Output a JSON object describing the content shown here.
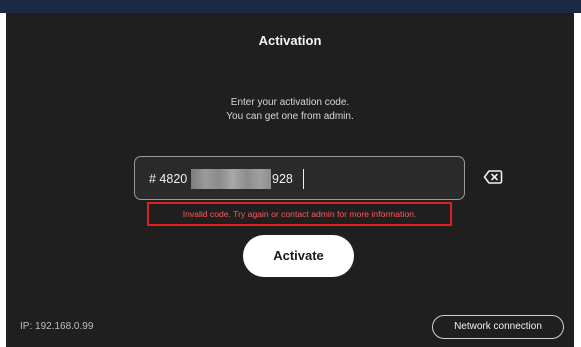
{
  "screen": {
    "title": "Activation",
    "instruction_line1": "Enter your activation code.",
    "instruction_line2": "You can get one from admin."
  },
  "code_input": {
    "prefix": "# 4820",
    "suffix": "928",
    "redacted": true
  },
  "error": {
    "message": "Invalid code. Try again or contact admin for more information.",
    "color": "#ff5a5a",
    "highlight_color": "#e02020"
  },
  "actions": {
    "activate_label": "Activate",
    "network_label": "Network connection"
  },
  "status": {
    "ip_text": "IP: 192.168.0.99"
  },
  "icons": {
    "clear_input": "backspace-icon"
  }
}
